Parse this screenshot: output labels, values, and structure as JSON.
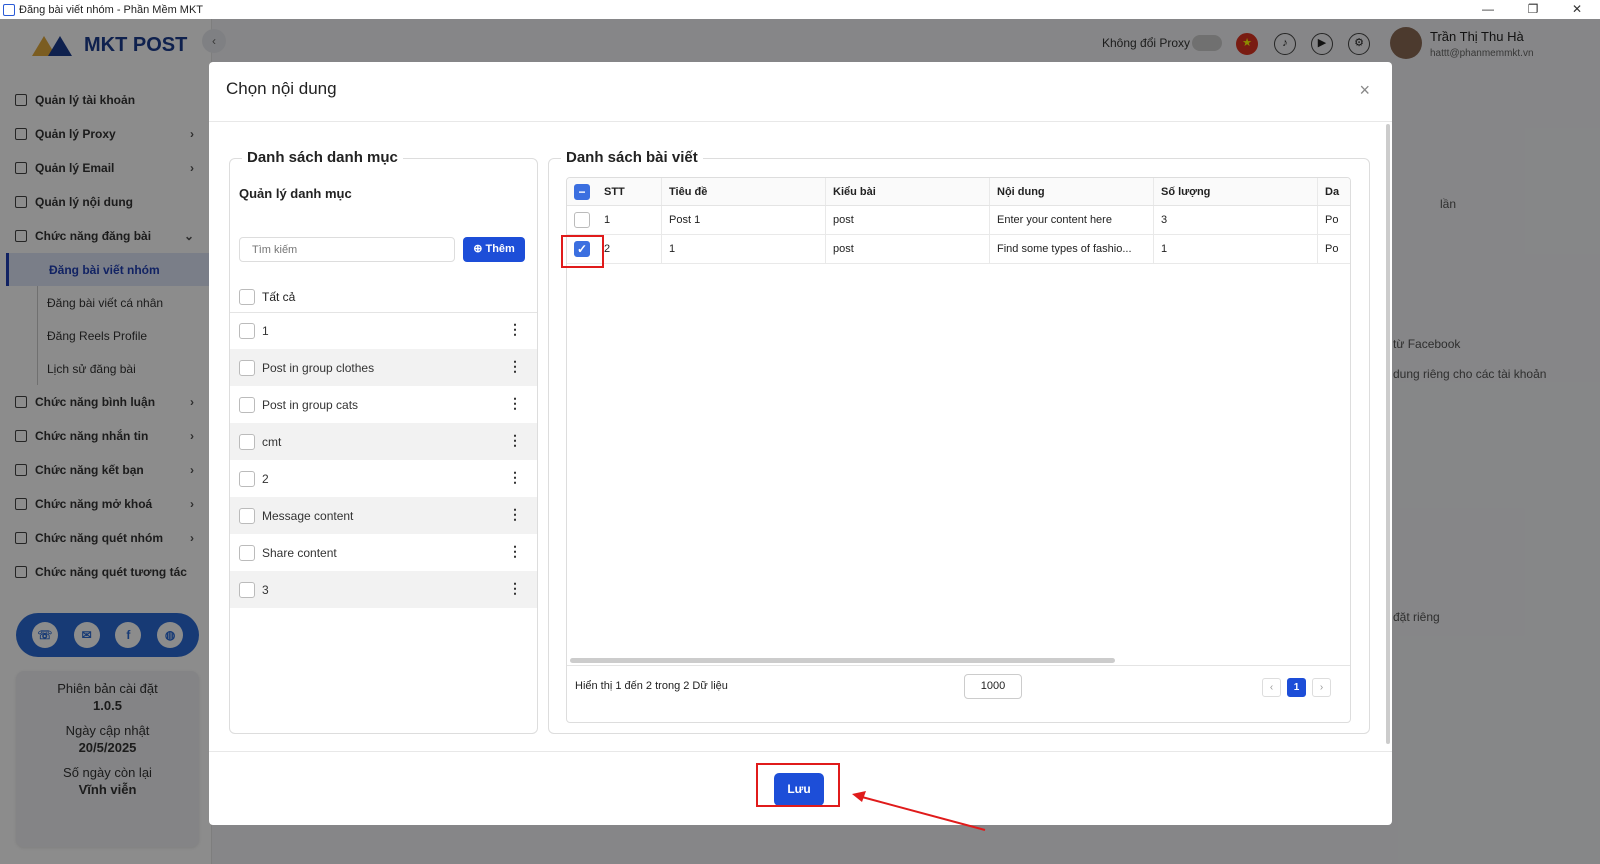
{
  "window": {
    "title": "Đăng bài viết nhóm - Phần Mềm MKT",
    "min": "—",
    "restore": "❐",
    "close": "✕"
  },
  "logo": {
    "text": "MKT POST"
  },
  "sidebar": {
    "items": [
      {
        "label": "Quản lý tài khoản",
        "chevron": ""
      },
      {
        "label": "Quản lý Proxy",
        "chevron": "›"
      },
      {
        "label": "Quản lý Email",
        "chevron": "›"
      },
      {
        "label": "Quản lý nội dung",
        "chevron": ""
      },
      {
        "label": "Chức năng đăng bài",
        "chevron": "⌄"
      }
    ],
    "subitems": [
      {
        "label": "Đăng bài viết nhóm"
      },
      {
        "label": "Đăng bài viết cá nhân"
      },
      {
        "label": "Đăng Reels Profile"
      },
      {
        "label": "Lịch sử đăng bài"
      }
    ],
    "items2": [
      {
        "label": "Chức năng bình luận",
        "chevron": "›"
      },
      {
        "label": "Chức năng nhắn tin",
        "chevron": "›"
      },
      {
        "label": "Chức năng kết bạn",
        "chevron": "›"
      },
      {
        "label": "Chức năng mở khoá",
        "chevron": "›"
      },
      {
        "label": "Chức năng quét nhóm",
        "chevron": "›"
      },
      {
        "label": "Chức năng quét tương tác",
        "chevron": ""
      }
    ],
    "version_label": "Phiên bản cài đặt",
    "version_value": "1.0.5",
    "update_label": "Ngày cập nhật",
    "update_value": "20/5/2025",
    "days_label": "Số ngày còn lại",
    "days_value": "Vĩnh viễn"
  },
  "topbar": {
    "proxy_label": "Không đổi Proxy",
    "user_name": "Trần Thị Thu Hà",
    "user_email": "hattt@phanmemmkt.vn"
  },
  "background": {
    "lan": "lần",
    "facebook": "từ Facebook",
    "dung_rieng": "dung riêng cho các tài khoản",
    "dat_rieng": "đặt riêng"
  },
  "modal": {
    "title": "Chọn nội dung",
    "close": "×",
    "categories": {
      "legend": "Danh sách danh mục",
      "heading": "Quản lý danh mục",
      "search_placeholder": "Tìm kiếm",
      "add_label": "Thêm",
      "all_label": "Tất cả",
      "items": [
        "1",
        "Post in group clothes",
        "Post in group cats",
        "cmt",
        "2",
        "Message content",
        "Share content",
        "3"
      ]
    },
    "posts": {
      "legend": "Danh sách bài viết",
      "columns": [
        "STT",
        "Tiêu đề",
        "Kiểu bài",
        "Nội dung",
        "Số lượng",
        "Da"
      ],
      "rows": [
        {
          "stt": "1",
          "title": "Post 1",
          "type": "post",
          "content": "Enter your content here",
          "qty": "3",
          "extra": "Po",
          "checked": false
        },
        {
          "stt": "2",
          "title": "1",
          "type": "post",
          "content": "Find some types of fashio...",
          "qty": "1",
          "extra": "Po",
          "checked": true
        }
      ],
      "info": "Hiển thị 1 đến 2 trong 2 Dữ liệu",
      "page_size": "1000",
      "current_page": "1"
    },
    "save_label": "Lưu"
  }
}
